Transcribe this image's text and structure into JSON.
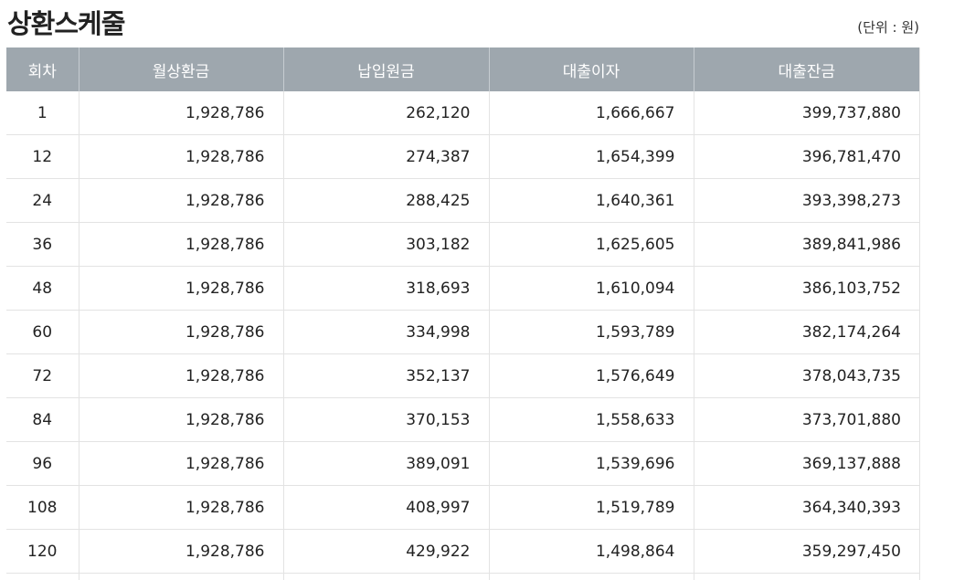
{
  "page": {
    "title": "상환스케줄",
    "unit_note": "(단위 : 원)"
  },
  "table": {
    "headers": {
      "round": "회차",
      "monthly_payment": "월상환금",
      "principal_paid": "납입원금",
      "loan_interest": "대출이자",
      "loan_balance": "대출잔금"
    },
    "rows": [
      {
        "round": "1",
        "monthly_payment": "1,928,786",
        "principal_paid": "262,120",
        "loan_interest": "1,666,667",
        "loan_balance": "399,737,880"
      },
      {
        "round": "12",
        "monthly_payment": "1,928,786",
        "principal_paid": "274,387",
        "loan_interest": "1,654,399",
        "loan_balance": "396,781,470"
      },
      {
        "round": "24",
        "monthly_payment": "1,928,786",
        "principal_paid": "288,425",
        "loan_interest": "1,640,361",
        "loan_balance": "393,398,273"
      },
      {
        "round": "36",
        "monthly_payment": "1,928,786",
        "principal_paid": "303,182",
        "loan_interest": "1,625,605",
        "loan_balance": "389,841,986"
      },
      {
        "round": "48",
        "monthly_payment": "1,928,786",
        "principal_paid": "318,693",
        "loan_interest": "1,610,094",
        "loan_balance": "386,103,752"
      },
      {
        "round": "60",
        "monthly_payment": "1,928,786",
        "principal_paid": "334,998",
        "loan_interest": "1,593,789",
        "loan_balance": "382,174,264"
      },
      {
        "round": "72",
        "monthly_payment": "1,928,786",
        "principal_paid": "352,137",
        "loan_interest": "1,576,649",
        "loan_balance": "378,043,735"
      },
      {
        "round": "84",
        "monthly_payment": "1,928,786",
        "principal_paid": "370,153",
        "loan_interest": "1,558,633",
        "loan_balance": "373,701,880"
      },
      {
        "round": "96",
        "monthly_payment": "1,928,786",
        "principal_paid": "389,091",
        "loan_interest": "1,539,696",
        "loan_balance": "369,137,888"
      },
      {
        "round": "108",
        "monthly_payment": "1,928,786",
        "principal_paid": "408,997",
        "loan_interest": "1,519,789",
        "loan_balance": "364,340,393"
      },
      {
        "round": "120",
        "monthly_payment": "1,928,786",
        "principal_paid": "429,922",
        "loan_interest": "1,498,864",
        "loan_balance": "359,297,450"
      }
    ]
  },
  "colors": {
    "header_bg": "#9ea7ae",
    "header_text": "#ffffff",
    "row_border": "#e3e3e3"
  }
}
